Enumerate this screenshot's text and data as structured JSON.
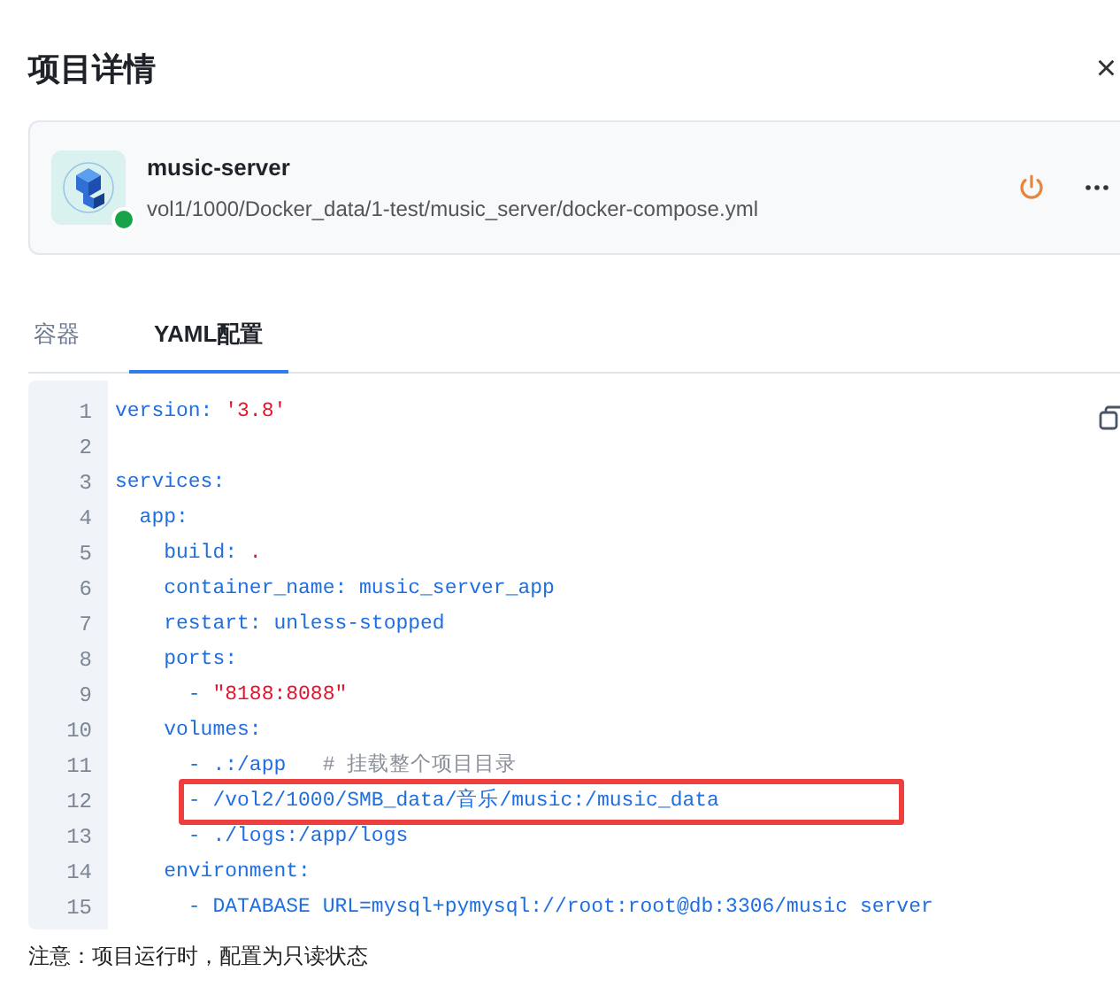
{
  "title": "项目详情",
  "close": "×",
  "project": {
    "name": "music-server",
    "path": "vol1/1000/Docker_data/1-test/music_server/docker-compose.yml",
    "running": true
  },
  "tabs": [
    {
      "label": "容器",
      "selected": false
    },
    {
      "label": "YAML配置",
      "selected": true
    }
  ],
  "code_lines": [
    {
      "number": "1",
      "highlighted": false,
      "segments": [
        {
          "text": "version: ",
          "kind": "key"
        },
        {
          "text": "'3.8'",
          "kind": "string"
        }
      ]
    },
    {
      "number": "2",
      "highlighted": false
    },
    {
      "number": "3",
      "highlighted": false,
      "segments": [
        {
          "text": "services:",
          "kind": "key"
        }
      ]
    },
    {
      "number": "4",
      "highlighted": false,
      "segments": [
        {
          "text": "  app:",
          "kind": "key"
        }
      ]
    },
    {
      "number": "5",
      "highlighted": false,
      "segments": [
        {
          "text": "    build: ",
          "kind": "key"
        },
        {
          "text": ".",
          "kind": "string"
        }
      ]
    },
    {
      "number": "6",
      "highlighted": false,
      "segments": [
        {
          "text": "    container_name: music_server_app",
          "kind": "key"
        }
      ]
    },
    {
      "number": "7",
      "highlighted": false,
      "segments": [
        {
          "text": "    restart: unless-stopped",
          "kind": "key"
        }
      ]
    },
    {
      "number": "8",
      "highlighted": false,
      "segments": [
        {
          "text": "    ports:",
          "kind": "key"
        }
      ]
    },
    {
      "number": "9",
      "highlighted": false,
      "segments": [
        {
          "text": "      - ",
          "kind": "key"
        },
        {
          "text": "\"8188:8088\"",
          "kind": "string"
        }
      ]
    },
    {
      "number": "10",
      "highlighted": false,
      "segments": [
        {
          "text": "    volumes:",
          "kind": "key"
        }
      ]
    },
    {
      "number": "11",
      "highlighted": false,
      "segments": [
        {
          "text": "      - .:/app   ",
          "kind": "key"
        },
        {
          "text": "# 挂载整个项目目录",
          "kind": "comment"
        }
      ]
    },
    {
      "number": "12",
      "highlighted": true,
      "segments": [
        {
          "text": "      - /vol2/1000/SMB_data/音乐/music:/music_data",
          "kind": "key"
        }
      ]
    },
    {
      "number": "13",
      "highlighted": false,
      "segments": [
        {
          "text": "      - ./logs:/app/logs",
          "kind": "key"
        }
      ]
    },
    {
      "number": "14",
      "highlighted": false,
      "segments": [
        {
          "text": "    environment:",
          "kind": "key"
        }
      ]
    },
    {
      "number": "15",
      "highlighted": false,
      "segments": [
        {
          "text": "      - DATABASE URL=mysql+pymysql://root:root@db:3306/music server",
          "kind": "key"
        }
      ]
    }
  ],
  "note": "注意：项目运行时，配置为只读状态"
}
